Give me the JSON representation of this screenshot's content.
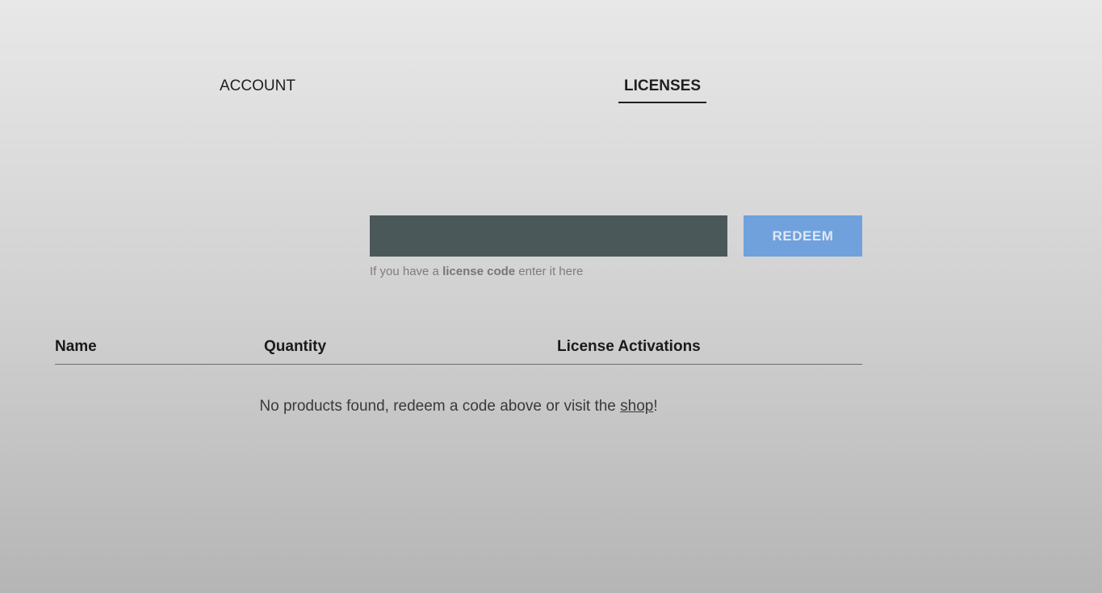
{
  "tabs": {
    "account": "ACCOUNT",
    "licenses": "LICENSES"
  },
  "redeem": {
    "input_value": "",
    "button_label": "REDEEM",
    "hint_prefix": "If you have a ",
    "hint_bold": "license code",
    "hint_suffix": " enter it here"
  },
  "table": {
    "headers": [
      "Name",
      "Quantity",
      "License Activations"
    ],
    "empty_prefix": "No products found, redeem a code above or visit the ",
    "empty_link": "shop",
    "empty_suffix": "!"
  }
}
